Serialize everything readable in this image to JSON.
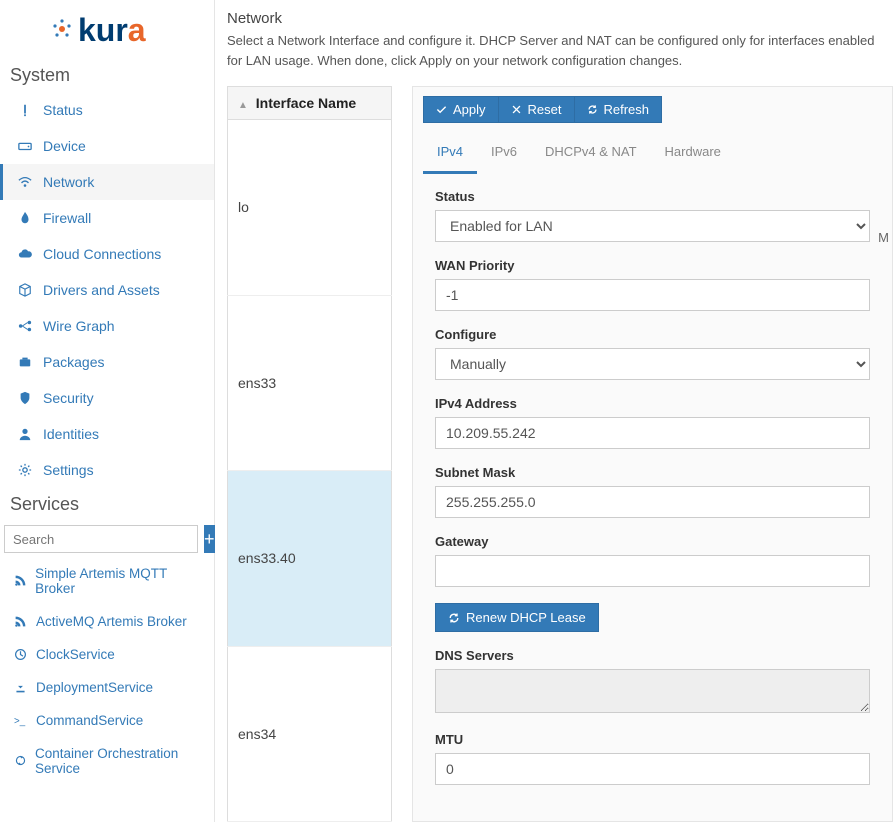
{
  "logo_text": "kura",
  "nav": {
    "system_heading": "System",
    "services_heading": "Services",
    "items": [
      {
        "icon": "info",
        "label": "Status"
      },
      {
        "icon": "hdd",
        "label": "Device"
      },
      {
        "icon": "wifi",
        "label": "Network"
      },
      {
        "icon": "fire",
        "label": "Firewall"
      },
      {
        "icon": "cloud",
        "label": "Cloud Connections"
      },
      {
        "icon": "cube",
        "label": "Drivers and Assets"
      },
      {
        "icon": "graph",
        "label": "Wire Graph"
      },
      {
        "icon": "briefcase",
        "label": "Packages"
      },
      {
        "icon": "shield",
        "label": "Security"
      },
      {
        "icon": "user",
        "label": "Identities"
      },
      {
        "icon": "gear",
        "label": "Settings"
      }
    ],
    "active_index": 2,
    "search_placeholder": "Search",
    "services": [
      {
        "icon": "rss",
        "label": "Simple Artemis MQTT Broker"
      },
      {
        "icon": "rss",
        "label": "ActiveMQ Artemis Broker"
      },
      {
        "icon": "clock",
        "label": "ClockService"
      },
      {
        "icon": "download",
        "label": "DeploymentService"
      },
      {
        "icon": "terminal",
        "label": "CommandService"
      },
      {
        "icon": "arrows",
        "label": "Container Orchestration Service"
      }
    ]
  },
  "page": {
    "title": "Network",
    "description": "Select a Network Interface and configure it. DHCP Server and NAT can be configured only for interfaces enabled for LAN usage. When done, click Apply on your network configuration changes."
  },
  "interfaces": {
    "header": "Interface Name",
    "rows": [
      "lo",
      "ens33",
      "ens33.40",
      "ens34"
    ],
    "selected_index": 2
  },
  "buttons": {
    "apply": "Apply",
    "reset": "Reset",
    "refresh": "Refresh",
    "renew": "Renew DHCP Lease"
  },
  "tabs": [
    "IPv4",
    "IPv6",
    "DHCPv4 & NAT",
    "Hardware"
  ],
  "active_tab": 0,
  "form": {
    "status_label": "Status",
    "status_value": "Enabled for LAN",
    "wan_priority_label": "WAN Priority",
    "wan_priority_value": "-1",
    "configure_label": "Configure",
    "configure_value": "Manually",
    "ipv4_label": "IPv4 Address",
    "ipv4_value": "10.209.55.242",
    "subnet_label": "Subnet Mask",
    "subnet_value": "255.255.255.0",
    "gateway_label": "Gateway",
    "gateway_value": "",
    "dns_label": "DNS Servers",
    "dns_value": "",
    "mtu_label": "MTU",
    "mtu_value": "0",
    "side_hint": "M"
  }
}
